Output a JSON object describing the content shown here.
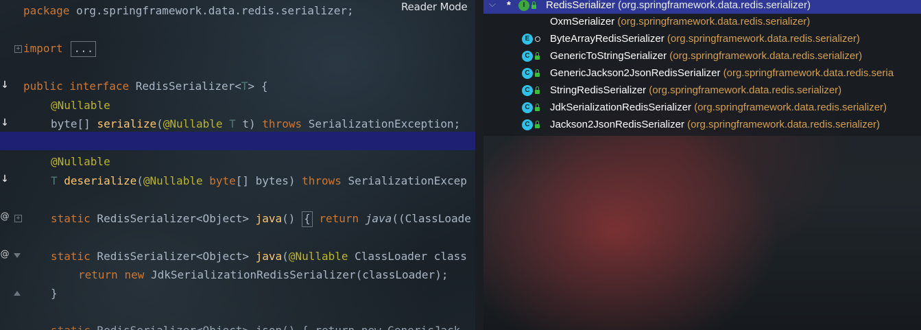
{
  "editor": {
    "reader_mode_label": "Reader Mode",
    "lines": {
      "package_kw": "package",
      "package_name": " org.springframework.data.redis.serializer;",
      "import_kw": "import",
      "import_fold": "...",
      "public_kw": "public",
      "interface_kw": "interface",
      "interface_name": " RedisSerializer<",
      "type_param": "T",
      "interface_tail": "> {",
      "nullable": "@Nullable",
      "byte_arr": "byte[] ",
      "serialize_fn": "serialize",
      "paren_open": "(",
      "t_param": "T",
      "t_name": " t) ",
      "throws_kw": "throws",
      "exc": " SerializationException;",
      "deserialize_fn": "deserialize",
      "byte_kw": "byte",
      "bytes_param": "[] bytes) ",
      "exc2": " SerializationExcep",
      "static_kw": "static",
      "rs_object": " RedisSerializer<Object> ",
      "java_fn": "java",
      "java_parens": "() ",
      "brace": "{",
      "return_kw": "return",
      "java_call": "java",
      "java_call_tail": "((ClassLoade",
      "java2_open": "(",
      "classloader_tail": " ClassLoader class",
      "new_kw": "new",
      "jdk_call": " JdkSerializationRedisSerializer(classLoader);",
      "close_brace": "}",
      "json_partial": " RedisSerializer<Object> json() { return new GenericJack"
    }
  },
  "hierarchy": {
    "root": {
      "name": "RedisSerializer",
      "package": "(org.springframework.data.redis.serializer)",
      "icon": "interface-icon",
      "icon_letter": "I"
    },
    "items": [
      {
        "name": "OxmSerializer",
        "package": "(org.springframework.data.redis.serializer)",
        "icon": "none"
      },
      {
        "name": "ByteArrayRedisSerializer",
        "package": "(org.springframework.data.redis.serializer)",
        "icon": "enum-icon",
        "icon_letter": "E"
      },
      {
        "name": "GenericToStringSerializer",
        "package": "(org.springframework.data.redis.serializer)",
        "icon": "class-icon",
        "icon_letter": "C"
      },
      {
        "name": "GenericJackson2JsonRedisSerializer",
        "package": "(org.springframework.data.redis.seria",
        "icon": "class-icon",
        "icon_letter": "C"
      },
      {
        "name": "StringRedisSerializer",
        "package": "(org.springframework.data.redis.serializer)",
        "icon": "class-icon",
        "icon_letter": "C"
      },
      {
        "name": "JdkSerializationRedisSerializer",
        "package": "(org.springframework.data.redis.serializer)",
        "icon": "class-icon",
        "icon_letter": "C"
      },
      {
        "name": "Jackson2JsonRedisSerializer",
        "package": "(org.springframework.data.redis.serializer)",
        "icon": "class-icon",
        "icon_letter": "C"
      }
    ]
  },
  "colors": {
    "keyword": "#cc7832",
    "annotation": "#bbb529",
    "method": "#ffc66d",
    "selection": "#2f3897",
    "package": "#d3a04d"
  }
}
